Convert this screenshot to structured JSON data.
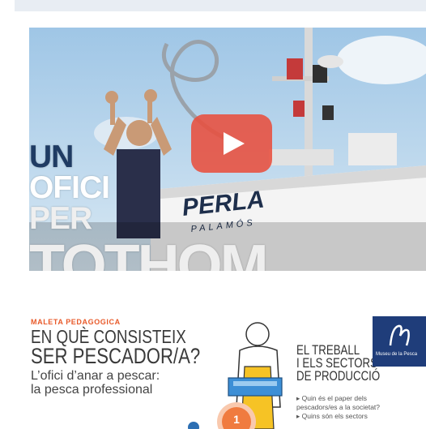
{
  "video": {
    "title_lines": [
      "UN",
      "OFICI",
      "PER",
      "TOTHOM"
    ],
    "boat_name": "PERLA",
    "boat_port": "PALAMÓS",
    "play_label": "play-button"
  },
  "card": {
    "kicker": "MALETA PEDAGOGICA",
    "heading_line1": "EN QUÈ CONSISTEIX",
    "heading_line2": "SER PESCADOR/A?",
    "subtitle_line1": "L’ofici d’anar a pescar:",
    "subtitle_line2": "la pesca professional",
    "section_line1": "EL TREBALL",
    "section_line2": "I ELS SECTORS",
    "section_line3": "DE PRODUCCIÓ",
    "question1_line1": "▸ Quin és el paper dels",
    "question1_line2": "pescadors/es a la societat?",
    "question2_line1": "▸ Quins són els sectors",
    "badge_number": "1",
    "logo_text": "Museu de la Pesca"
  },
  "colors": {
    "play_red": "#e84e3e",
    "title_blue": "#1f3b63",
    "kicker_orange": "#e85a2a",
    "logo_navy": "#1f3d7a"
  }
}
